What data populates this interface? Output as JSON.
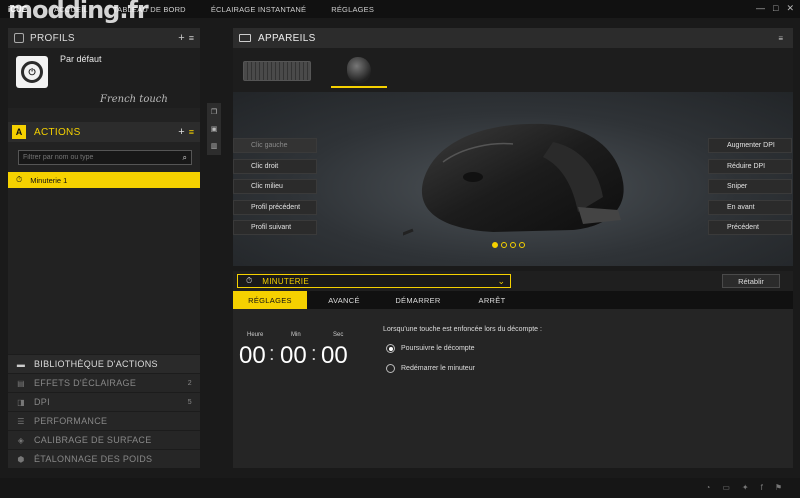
{
  "app": {
    "brand": "iCUE"
  },
  "menu": {
    "items": [
      "ACCUEIL",
      "TABLEAU DE BORD",
      "ÉCLAIRAGE INSTANTANÉ",
      "RÉGLAGES"
    ]
  },
  "window_controls": {
    "minimize": "—",
    "maximize": "□",
    "close": "✕"
  },
  "watermark": "modding.fr",
  "profiles": {
    "title": "PROFILS",
    "add": "+",
    "menu": "≡",
    "current": {
      "name": "Par défaut",
      "subtitle": "French touch",
      "logo": "icue-logo-icon"
    }
  },
  "actions": {
    "badge": "A",
    "title": "ACTIONS",
    "add": "+",
    "menu": "≡",
    "filter_placeholder": "Filtrer par nom ou type",
    "items": [
      {
        "label": "Minuterie 1",
        "icon": "timer-icon"
      }
    ]
  },
  "library": [
    {
      "label": "BIBLIOTHÈQUE D'ACTIONS",
      "icon": "folder-icon",
      "count": ""
    },
    {
      "label": "EFFETS D'ÉCLAIRAGE",
      "icon": "lighting-icon",
      "count": "2"
    },
    {
      "label": "DPI",
      "icon": "dpi-icon",
      "count": "5"
    },
    {
      "label": "PERFORMANCE",
      "icon": "performance-icon",
      "count": ""
    },
    {
      "label": "CALIBRAGE DE SURFACE",
      "icon": "surface-icon",
      "count": ""
    },
    {
      "label": "ÉTALONNAGE DES POIDS",
      "icon": "weight-icon",
      "count": ""
    }
  ],
  "devices": {
    "title": "APPAREILS",
    "menu": "≡",
    "list": [
      {
        "name": "keyboard",
        "icon": "keyboard-icon",
        "selected": false
      },
      {
        "name": "mouse",
        "icon": "mouse-icon",
        "selected": true
      }
    ]
  },
  "buttons_left": [
    "Clic gauche",
    "Clic droit",
    "Clic milieu",
    "Profil précédent",
    "Profil suivant"
  ],
  "buttons_right": [
    "Augmenter DPI",
    "Réduire DPI",
    "Sniper",
    "En avant",
    "Précédent"
  ],
  "carousel": {
    "pages": 4,
    "active": 0
  },
  "timer_select": {
    "label": "MINUTERIE",
    "icon": "timer-icon",
    "chevron": "⌄"
  },
  "reset_button": "Rétablir",
  "tabs": [
    {
      "label": "RÉGLAGES",
      "active": true
    },
    {
      "label": "AVANCÉ",
      "active": false
    },
    {
      "label": "DÉMARRER",
      "active": false
    },
    {
      "label": "ARRÊT",
      "active": false
    }
  ],
  "timer": {
    "labels": {
      "hours": "Heure",
      "minutes": "Min",
      "seconds": "Sec"
    },
    "values": {
      "hours": "00",
      "minutes": "00",
      "seconds": "00"
    },
    "separator": ":"
  },
  "options": {
    "question": "Lorsqu'une touche est enfoncée lors du décompte :",
    "choices": [
      {
        "label": "Poursuivre le décompte",
        "selected": true
      },
      {
        "label": "Redémarrer le minuteur",
        "selected": false
      }
    ]
  },
  "colors": {
    "accent": "#f5d100",
    "bg": "#1a1a1a",
    "panel": "#252525"
  }
}
